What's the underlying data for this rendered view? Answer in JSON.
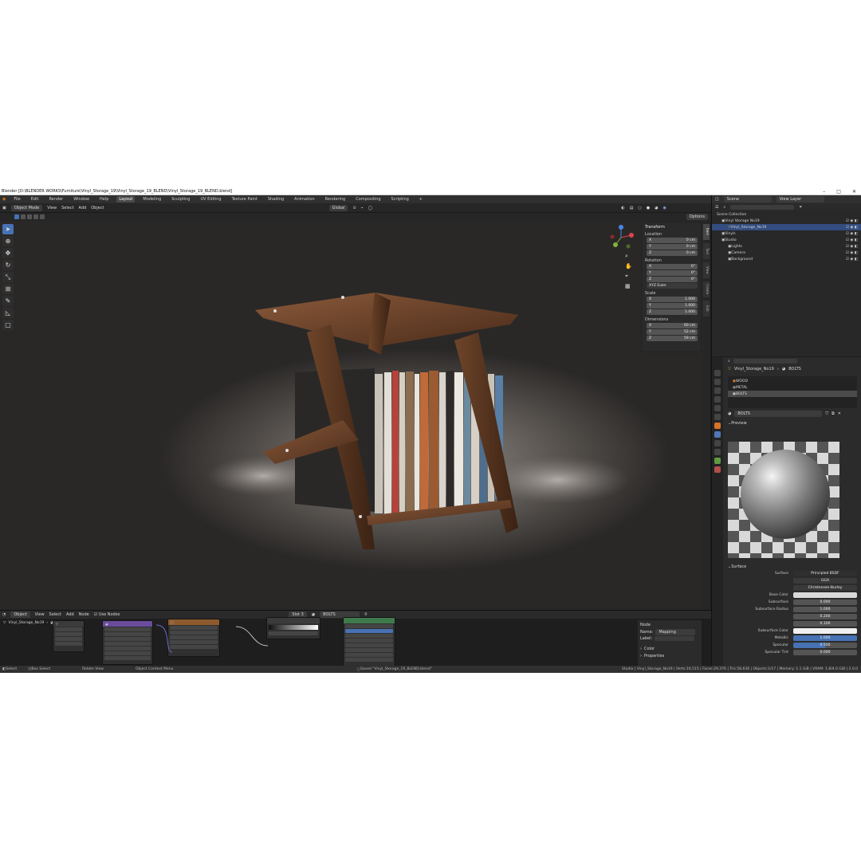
{
  "titlebar": {
    "title": "Blender [D:\\BLENDER WORKS\\Furniture\\Vinyl_Storage_19\\Vinyl_Storage_19_BLEND\\Vinyl_Storage_19_BLEND.blend]",
    "min": "–",
    "max": "□",
    "close": "✕"
  },
  "menu": [
    "File",
    "Edit",
    "Render",
    "Window",
    "Help"
  ],
  "workspaces": [
    "Layout",
    "Modeling",
    "Sculpting",
    "UV Editing",
    "Texture Paint",
    "Shading",
    "Animation",
    "Rendering",
    "Compositing",
    "Scripting"
  ],
  "workspace_add": "+",
  "viewport": {
    "mode": "Object Mode",
    "menus": [
      "View",
      "Select",
      "Add",
      "Object"
    ],
    "orientation": "Global",
    "options": "Options",
    "nav_axes": {
      "x": "X",
      "y": "Y",
      "z": "Z"
    }
  },
  "transform": {
    "title": "Transform",
    "location_label": "Location",
    "location": [
      {
        "axis": "X",
        "value": "0 cm"
      },
      {
        "axis": "Y",
        "value": "0 cm"
      },
      {
        "axis": "Z",
        "value": "0 cm"
      }
    ],
    "rotation_label": "Rotation",
    "rotation": [
      {
        "axis": "X",
        "value": "0°"
      },
      {
        "axis": "Y",
        "value": "0°"
      },
      {
        "axis": "Z",
        "value": "0°"
      }
    ],
    "rotation_mode": "XYZ Euler",
    "scale_label": "Scale",
    "scale": [
      {
        "axis": "X",
        "value": "1.000"
      },
      {
        "axis": "Y",
        "value": "1.000"
      },
      {
        "axis": "Z",
        "value": "1.000"
      }
    ],
    "dimensions_label": "Dimensions",
    "dimensions": [
      {
        "axis": "X",
        "value": "60 cm"
      },
      {
        "axis": "Y",
        "value": "52 cm"
      },
      {
        "axis": "Z",
        "value": "59 cm"
      }
    ]
  },
  "sidetabs": [
    "Item",
    "Tool",
    "View",
    "Create",
    "Edit"
  ],
  "outliner": {
    "scene": "Scene",
    "view_layer": "View Layer",
    "rows": [
      {
        "label": "Scene Collection",
        "indent": 0
      },
      {
        "label": "Vinyl Storage No19",
        "indent": 1
      },
      {
        "label": "Vinyl_Storage_No19",
        "indent": 2,
        "selected": true
      },
      {
        "label": "Vinyls",
        "indent": 1
      },
      {
        "label": "Studio",
        "indent": 1
      },
      {
        "label": "Lights",
        "indent": 2
      },
      {
        "label": "Camera",
        "indent": 2
      },
      {
        "label": "Background",
        "indent": 2
      }
    ]
  },
  "properties": {
    "breadcrumb_object": "Vinyl_Storage_No19",
    "breadcrumb_material": "BOLTS",
    "slots": [
      "WOOD",
      "METAL",
      "BOLTS"
    ],
    "material_name": "BOLTS",
    "preview_label": "Preview",
    "surface_label": "Surface",
    "rows": [
      {
        "label": "Surface",
        "value": "Principled BSDF"
      },
      {
        "label": "",
        "value": "GGX"
      },
      {
        "label": "",
        "value": "Christensen-Burley"
      },
      {
        "label": "Base Color",
        "value": ""
      },
      {
        "label": "Subsurface",
        "value": "0.000"
      },
      {
        "label": "Subsurface Radius",
        "value": "1.000"
      },
      {
        "label": "",
        "value": "0.200"
      },
      {
        "label": "",
        "value": "0.100"
      },
      {
        "label": "Subsurface Color",
        "value": ""
      },
      {
        "label": "Metallic",
        "value": "1.000"
      },
      {
        "label": "Specular",
        "value": "0.500"
      },
      {
        "label": "Specular Tint",
        "value": "0.000"
      }
    ]
  },
  "node_editor": {
    "type": "Object",
    "menus": [
      "View",
      "Select",
      "Add",
      "Node"
    ],
    "use_nodes": "Use Nodes",
    "slot": "Slot 3",
    "material": "BOLTS",
    "object": "Vinyl_Storage_No19",
    "node_panel_title": "Node",
    "name_label": "Name:",
    "name_value": "Mapping",
    "label_label": "Label:",
    "color_label": "Color",
    "properties_label": "Properties"
  },
  "status": {
    "select": "Select",
    "box_select": "Box Select",
    "rotate_view": "Rotate View",
    "context_menu": "Object Context Menu",
    "saved": "Saved \"Vinyl_Storage_19_BLEND.blend\"",
    "stats": "Studio | Vinyl_Storage_No19 | Verts:16,515 | Faces:29,376 | Tris:58,636 | Objects:1/17 | Memory: 1.1 GiB | VRAM: 1.8/4.0 GiB | 2.0.0"
  }
}
